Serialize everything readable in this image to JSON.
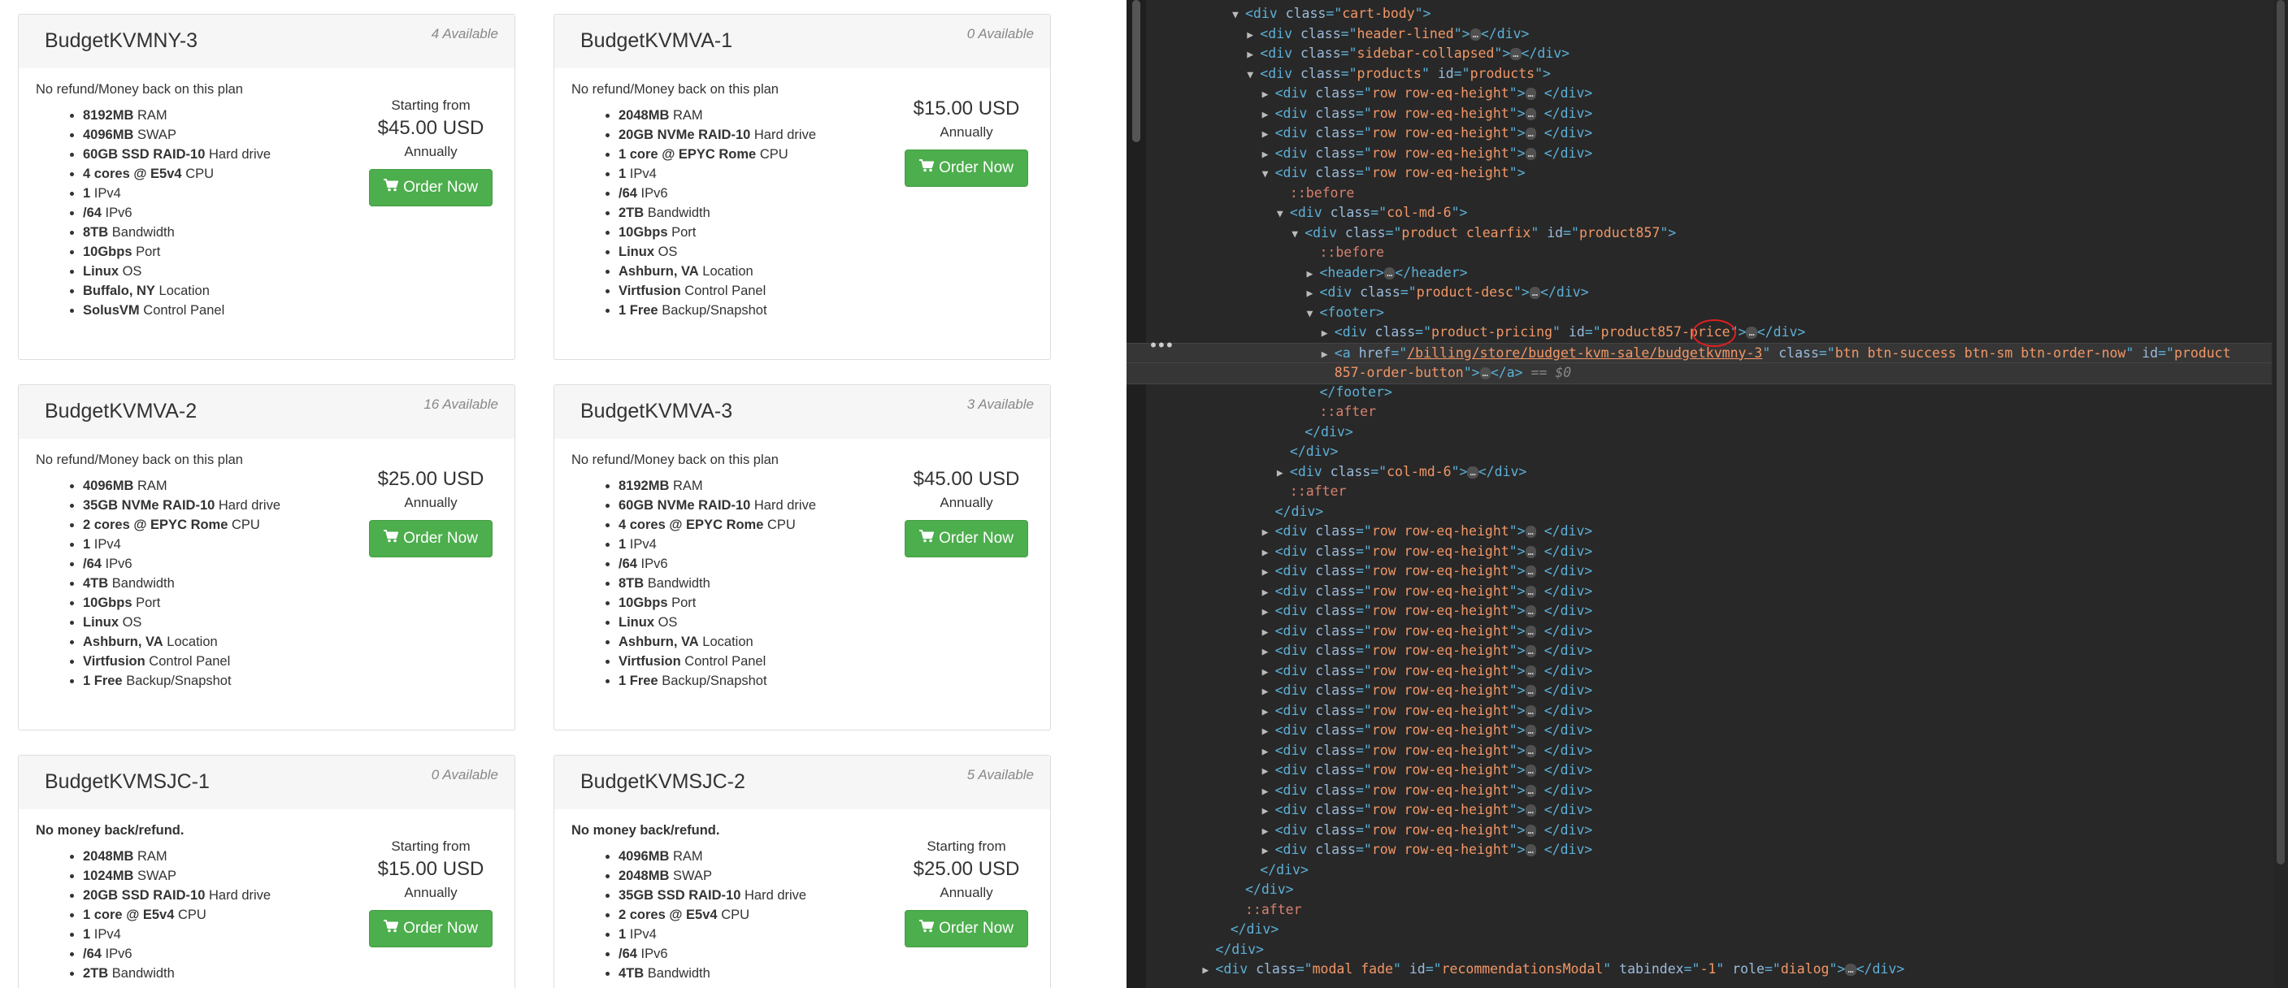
{
  "products": [
    {
      "name": "BudgetKVMNY-3",
      "available": "4 Available",
      "refund": "No refund/Money back on this plan",
      "refund_bold": false,
      "features": [
        [
          "8192MB",
          "RAM"
        ],
        [
          "4096MB",
          "SWAP"
        ],
        [
          "60GB SSD RAID-10",
          "Hard drive"
        ],
        [
          "4 cores @ E5v4",
          "CPU"
        ],
        [
          "1",
          "IPv4"
        ],
        [
          "/64",
          "IPv6"
        ],
        [
          "8TB",
          "Bandwidth"
        ],
        [
          "10Gbps",
          "Port"
        ],
        [
          "Linux",
          "OS"
        ],
        [
          "Buffalo, NY",
          "Location"
        ],
        [
          "SolusVM",
          "Control Panel"
        ]
      ],
      "starting": "Starting from",
      "price": "$45.00 USD",
      "cycle": "Annually",
      "button": "Order Now"
    },
    {
      "name": "BudgetKVMVA-1",
      "available": "0 Available",
      "refund": "No refund/Money back on this plan",
      "refund_bold": false,
      "features": [
        [
          "2048MB",
          "RAM"
        ],
        [
          "20GB NVMe RAID-10",
          "Hard drive"
        ],
        [
          "1 core @ EPYC Rome",
          "CPU"
        ],
        [
          "1",
          "IPv4"
        ],
        [
          "/64",
          "IPv6"
        ],
        [
          "2TB",
          "Bandwidth"
        ],
        [
          "10Gbps",
          "Port"
        ],
        [
          "Linux",
          "OS"
        ],
        [
          "Ashburn, VA",
          "Location"
        ],
        [
          "Virtfusion",
          "Control Panel"
        ],
        [
          "1 Free",
          "Backup/Snapshot"
        ]
      ],
      "starting": "",
      "price": "$15.00 USD",
      "cycle": "Annually",
      "button": "Order Now"
    },
    {
      "name": "BudgetKVMVA-2",
      "available": "16 Available",
      "refund": "No refund/Money back on this plan",
      "refund_bold": false,
      "features": [
        [
          "4096MB",
          "RAM"
        ],
        [
          "35GB NVMe RAID-10",
          "Hard drive"
        ],
        [
          "2 cores @ EPYC Rome",
          "CPU"
        ],
        [
          "1",
          "IPv4"
        ],
        [
          "/64",
          "IPv6"
        ],
        [
          "4TB",
          "Bandwidth"
        ],
        [
          "10Gbps",
          "Port"
        ],
        [
          "Linux",
          "OS"
        ],
        [
          "Ashburn, VA",
          "Location"
        ],
        [
          "Virtfusion",
          "Control Panel"
        ],
        [
          "1 Free",
          "Backup/Snapshot"
        ]
      ],
      "starting": "",
      "price": "$25.00 USD",
      "cycle": "Annually",
      "button": "Order Now"
    },
    {
      "name": "BudgetKVMVA-3",
      "available": "3 Available",
      "refund": "No refund/Money back on this plan",
      "refund_bold": false,
      "features": [
        [
          "8192MB",
          "RAM"
        ],
        [
          "60GB NVMe RAID-10",
          "Hard drive"
        ],
        [
          "4 cores @ EPYC Rome",
          "CPU"
        ],
        [
          "1",
          "IPv4"
        ],
        [
          "/64",
          "IPv6"
        ],
        [
          "8TB",
          "Bandwidth"
        ],
        [
          "10Gbps",
          "Port"
        ],
        [
          "Linux",
          "OS"
        ],
        [
          "Ashburn, VA",
          "Location"
        ],
        [
          "Virtfusion",
          "Control Panel"
        ],
        [
          "1 Free",
          "Backup/Snapshot"
        ]
      ],
      "starting": "",
      "price": "$45.00 USD",
      "cycle": "Annually",
      "button": "Order Now"
    },
    {
      "name": "BudgetKVMSJC-1",
      "available": "0 Available",
      "refund": "No money back/refund.",
      "refund_bold": true,
      "features": [
        [
          "2048MB",
          "RAM"
        ],
        [
          "1024MB",
          "SWAP"
        ],
        [
          "20GB SSD RAID-10",
          "Hard drive"
        ],
        [
          "1 core @ E5v4",
          "CPU"
        ],
        [
          "1",
          "IPv4"
        ],
        [
          "/64",
          "IPv6"
        ],
        [
          "2TB",
          "Bandwidth"
        ]
      ],
      "starting": "Starting from",
      "price": "$15.00 USD",
      "cycle": "Annually",
      "button": "Order Now"
    },
    {
      "name": "BudgetKVMSJC-2",
      "available": "5 Available",
      "refund": "No money back/refund.",
      "refund_bold": true,
      "features": [
        [
          "4096MB",
          "RAM"
        ],
        [
          "2048MB",
          "SWAP"
        ],
        [
          "35GB SSD RAID-10",
          "Hard drive"
        ],
        [
          "2 cores @ E5v4",
          "CPU"
        ],
        [
          "1",
          "IPv4"
        ],
        [
          "/64",
          "IPv6"
        ],
        [
          "4TB",
          "Bandwidth"
        ]
      ],
      "starting": "Starting from",
      "price": "$25.00 USD",
      "cycle": "Annually",
      "button": "Order Now"
    }
  ],
  "devtools": {
    "ellipsis": "…",
    "row_class": "row row-eq-height",
    "lines": [
      {
        "indent": 0,
        "tw": "▼",
        "parts": [
          [
            "tag",
            "<div "
          ],
          [
            "attr",
            "class"
          ],
          [
            "tag",
            "=\""
          ],
          [
            "val",
            "cart-body"
          ],
          [
            "tag",
            "\">"
          ]
        ]
      },
      {
        "indent": 1,
        "tw": "▶",
        "parts": [
          [
            "tag",
            "<div "
          ],
          [
            "attr",
            "class"
          ],
          [
            "tag",
            "=\""
          ],
          [
            "val",
            "header-lined"
          ],
          [
            "tag",
            "\">"
          ],
          [
            "ell",
            "…"
          ],
          [
            "tag",
            "</div>"
          ]
        ]
      },
      {
        "indent": 1,
        "tw": "▶",
        "parts": [
          [
            "tag",
            "<div "
          ],
          [
            "attr",
            "class"
          ],
          [
            "tag",
            "=\""
          ],
          [
            "val",
            "sidebar-collapsed"
          ],
          [
            "tag",
            "\">"
          ],
          [
            "ell",
            "…"
          ],
          [
            "tag",
            "</div>"
          ]
        ]
      },
      {
        "indent": 1,
        "tw": "▼",
        "parts": [
          [
            "tag",
            "<div "
          ],
          [
            "attr",
            "class"
          ],
          [
            "tag",
            "=\""
          ],
          [
            "val",
            "products"
          ],
          [
            "tag",
            "\" "
          ],
          [
            "attr",
            "id"
          ],
          [
            "tag",
            "=\""
          ],
          [
            "val",
            "products"
          ],
          [
            "tag",
            "\">"
          ]
        ]
      },
      {
        "indent": 2,
        "tw": "▶",
        "row": true
      },
      {
        "indent": 2,
        "tw": "▶",
        "row": true
      },
      {
        "indent": 2,
        "tw": "▶",
        "row": true
      },
      {
        "indent": 2,
        "tw": "▶",
        "row": true
      },
      {
        "indent": 2,
        "tw": "▼",
        "parts": [
          [
            "tag",
            "<div "
          ],
          [
            "attr",
            "class"
          ],
          [
            "tag",
            "=\""
          ],
          [
            "val",
            "row row-eq-height"
          ],
          [
            "tag",
            "\">"
          ]
        ]
      },
      {
        "indent": 3,
        "tw": "",
        "parts": [
          [
            "pseudo",
            "::before"
          ]
        ]
      },
      {
        "indent": 3,
        "tw": "▼",
        "parts": [
          [
            "tag",
            "<div "
          ],
          [
            "attr",
            "class"
          ],
          [
            "tag",
            "=\""
          ],
          [
            "val",
            "col-md-6"
          ],
          [
            "tag",
            "\">"
          ]
        ]
      },
      {
        "indent": 4,
        "tw": "▼",
        "parts": [
          [
            "tag",
            "<div "
          ],
          [
            "attr",
            "class"
          ],
          [
            "tag",
            "=\""
          ],
          [
            "val",
            "product clearfix"
          ],
          [
            "tag",
            "\" "
          ],
          [
            "attr",
            "id"
          ],
          [
            "tag",
            "=\""
          ],
          [
            "val",
            "product857"
          ],
          [
            "tag",
            "\">"
          ]
        ]
      },
      {
        "indent": 5,
        "tw": "",
        "parts": [
          [
            "pseudo",
            "::before"
          ]
        ]
      },
      {
        "indent": 5,
        "tw": "▶",
        "parts": [
          [
            "tag",
            "<header>"
          ],
          [
            "ell",
            "…"
          ],
          [
            "tag",
            "</header>"
          ]
        ]
      },
      {
        "indent": 5,
        "tw": "▶",
        "parts": [
          [
            "tag",
            "<div "
          ],
          [
            "attr",
            "class"
          ],
          [
            "tag",
            "=\""
          ],
          [
            "val",
            "product-desc"
          ],
          [
            "tag",
            "\">"
          ],
          [
            "ell",
            "…"
          ],
          [
            "tag",
            "</div>"
          ]
        ]
      },
      {
        "indent": 5,
        "tw": "▼",
        "parts": [
          [
            "tag",
            "<footer>"
          ]
        ]
      },
      {
        "indent": 6,
        "tw": "▶",
        "parts": [
          [
            "tag",
            "<div "
          ],
          [
            "attr",
            "class"
          ],
          [
            "tag",
            "=\""
          ],
          [
            "val",
            "product-pricing"
          ],
          [
            "tag",
            "\" "
          ],
          [
            "attr",
            "id"
          ],
          [
            "tag",
            "=\""
          ],
          [
            "val",
            "product857-price"
          ],
          [
            "tag",
            "\">"
          ],
          [
            "ell",
            "…"
          ],
          [
            "tag",
            "</div>"
          ]
        ]
      },
      {
        "indent": 6,
        "tw": "▶",
        "selected": true,
        "parts": [
          [
            "tag",
            "<a "
          ],
          [
            "attr",
            "href"
          ],
          [
            "tag",
            "=\""
          ],
          [
            "link",
            "/billing/store/budget-kvm-sale/budgetkvmny-3"
          ],
          [
            "tag",
            "\" "
          ],
          [
            "attr",
            "class"
          ],
          [
            "tag",
            "=\""
          ],
          [
            "val",
            "btn btn-success btn-sm btn-order-now"
          ],
          [
            "tag",
            "\" "
          ],
          [
            "attr",
            "id"
          ],
          [
            "tag",
            "=\""
          ],
          [
            "val",
            "product"
          ]
        ]
      },
      {
        "indent": 6,
        "tw": "",
        "selected": true,
        "parts": [
          [
            "val",
            "857-order-button"
          ],
          [
            "tag",
            "\">"
          ],
          [
            "ell",
            "…"
          ],
          [
            "tag",
            "</a>"
          ],
          [
            "eq",
            " == $0"
          ]
        ]
      },
      {
        "indent": 5,
        "tw": "",
        "parts": [
          [
            "tag",
            "</footer>"
          ]
        ]
      },
      {
        "indent": 5,
        "tw": "",
        "parts": [
          [
            "pseudo",
            "::after"
          ]
        ]
      },
      {
        "indent": 4,
        "tw": "",
        "parts": [
          [
            "tag",
            "</div>"
          ]
        ]
      },
      {
        "indent": 3,
        "tw": "",
        "parts": [
          [
            "tag",
            "</div>"
          ]
        ]
      },
      {
        "indent": 3,
        "tw": "▶",
        "parts": [
          [
            "tag",
            "<div "
          ],
          [
            "attr",
            "class"
          ],
          [
            "tag",
            "=\""
          ],
          [
            "val",
            "col-md-6"
          ],
          [
            "tag",
            "\">"
          ],
          [
            "ell",
            "…"
          ],
          [
            "tag",
            "</div>"
          ]
        ]
      },
      {
        "indent": 3,
        "tw": "",
        "parts": [
          [
            "pseudo",
            "::after"
          ]
        ]
      },
      {
        "indent": 2,
        "tw": "",
        "parts": [
          [
            "tag",
            "</div>"
          ]
        ]
      },
      {
        "indent": 2,
        "tw": "▶",
        "row": true
      },
      {
        "indent": 2,
        "tw": "▶",
        "row": true
      },
      {
        "indent": 2,
        "tw": "▶",
        "row": true
      },
      {
        "indent": 2,
        "tw": "▶",
        "row": true
      },
      {
        "indent": 2,
        "tw": "▶",
        "row": true
      },
      {
        "indent": 2,
        "tw": "▶",
        "row": true
      },
      {
        "indent": 2,
        "tw": "▶",
        "row": true
      },
      {
        "indent": 2,
        "tw": "▶",
        "row": true
      },
      {
        "indent": 2,
        "tw": "▶",
        "row": true
      },
      {
        "indent": 2,
        "tw": "▶",
        "row": true
      },
      {
        "indent": 2,
        "tw": "▶",
        "row": true
      },
      {
        "indent": 2,
        "tw": "▶",
        "row": true
      },
      {
        "indent": 2,
        "tw": "▶",
        "row": true
      },
      {
        "indent": 2,
        "tw": "▶",
        "row": true
      },
      {
        "indent": 2,
        "tw": "▶",
        "row": true
      },
      {
        "indent": 2,
        "tw": "▶",
        "row": true
      },
      {
        "indent": 2,
        "tw": "▶",
        "row": true
      },
      {
        "indent": 1,
        "tw": "",
        "parts": [
          [
            "tag",
            "</div>"
          ]
        ]
      },
      {
        "indent": 0,
        "tw": "",
        "parts": [
          [
            "tag",
            "</div>"
          ]
        ]
      },
      {
        "indent": 0,
        "tw": "",
        "parts": [
          [
            "pseudo",
            "::after"
          ]
        ]
      },
      {
        "indent": -1,
        "tw": "",
        "parts": [
          [
            "tag",
            "</div>"
          ]
        ]
      },
      {
        "indent": -2,
        "tw": "",
        "parts": [
          [
            "tag",
            "</div>"
          ]
        ]
      },
      {
        "indent": -2,
        "tw": "▶",
        "parts": [
          [
            "tag",
            "<div "
          ],
          [
            "attr",
            "class"
          ],
          [
            "tag",
            "=\""
          ],
          [
            "val",
            "modal fade"
          ],
          [
            "tag",
            "\" "
          ],
          [
            "attr",
            "id"
          ],
          [
            "tag",
            "=\""
          ],
          [
            "val",
            "recommendationsModal"
          ],
          [
            "tag",
            "\" "
          ],
          [
            "attr",
            "tabindex"
          ],
          [
            "tag",
            "=\""
          ],
          [
            "val",
            "-1"
          ],
          [
            "tag",
            "\" "
          ],
          [
            "attr",
            "role"
          ],
          [
            "tag",
            "=\""
          ],
          [
            "val",
            "dialog"
          ],
          [
            "tag",
            "\">"
          ],
          [
            "ell",
            "…"
          ],
          [
            "tag",
            "</div>"
          ]
        ]
      }
    ]
  }
}
